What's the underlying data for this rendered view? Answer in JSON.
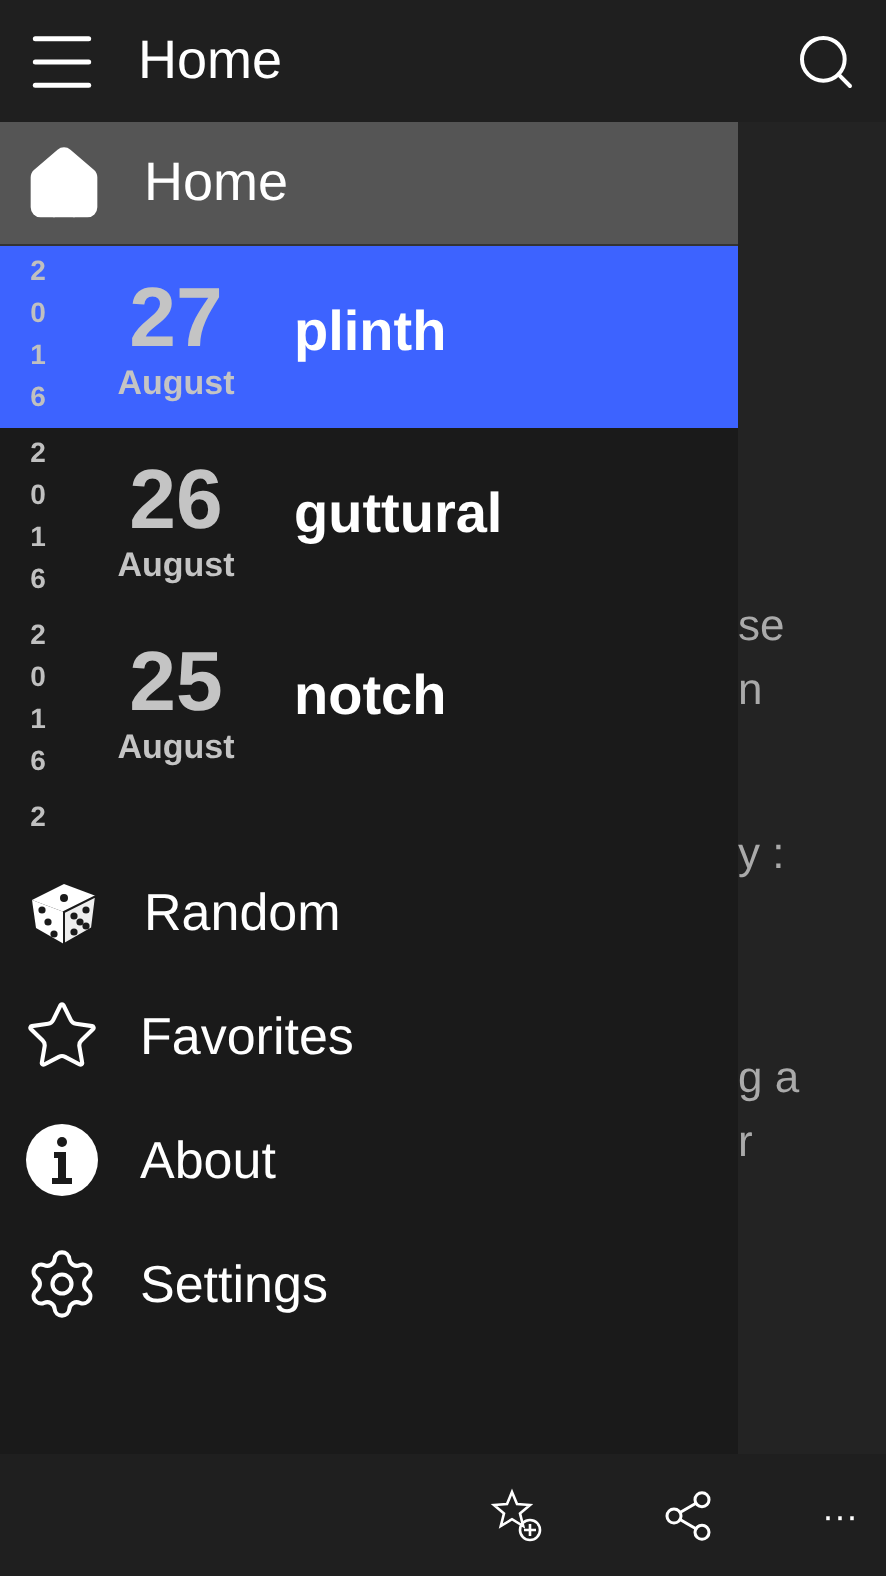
{
  "header": {
    "title": "Home"
  },
  "drawer": {
    "home": {
      "label": "Home",
      "selected": true
    },
    "entries": [
      {
        "year": "2016",
        "day": "27",
        "month": "August",
        "word": "plinth",
        "selected": true
      },
      {
        "year": "2016",
        "day": "26",
        "month": "August",
        "word": "guttural",
        "selected": false
      },
      {
        "year": "2016",
        "day": "25",
        "month": "August",
        "word": "notch",
        "selected": false
      },
      {
        "year": "2"
      }
    ],
    "menu": [
      {
        "kind": "dice",
        "label": "Random"
      },
      {
        "kind": "star",
        "label": "Favorites"
      },
      {
        "kind": "info",
        "label": "About"
      },
      {
        "kind": "gear",
        "label": "Settings"
      }
    ]
  },
  "background_text": [
    "se",
    "n",
    "y :",
    "g a",
    "r"
  ],
  "app_bar": {
    "more": "···"
  }
}
